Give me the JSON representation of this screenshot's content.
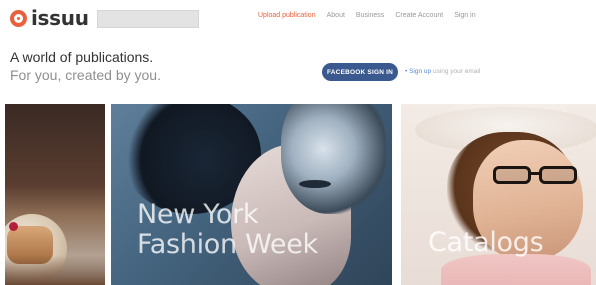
{
  "header": {
    "logo_text": "issuu",
    "nav": [
      {
        "label": "Upload publication",
        "active": true
      },
      {
        "label": "About",
        "active": false
      },
      {
        "label": "Business",
        "active": false
      },
      {
        "label": "Create Account",
        "active": false
      },
      {
        "label": "Sign in",
        "active": false
      }
    ]
  },
  "hero": {
    "line1": "A world of publications.",
    "line2": "For you, created by you.",
    "facebook_button": "FACEBOOK SIGN IN",
    "signup_prefix": "•",
    "signup_link": "Sign up",
    "signup_suffix": "using your email"
  },
  "cards": [
    {
      "label": ""
    },
    {
      "label_line1": "New York",
      "label_line2": "Fashion Week"
    },
    {
      "label": "Catalogs"
    }
  ],
  "colors": {
    "brand": "#e8613c",
    "facebook": "#3a5a8f",
    "link": "#5b8bd6"
  }
}
